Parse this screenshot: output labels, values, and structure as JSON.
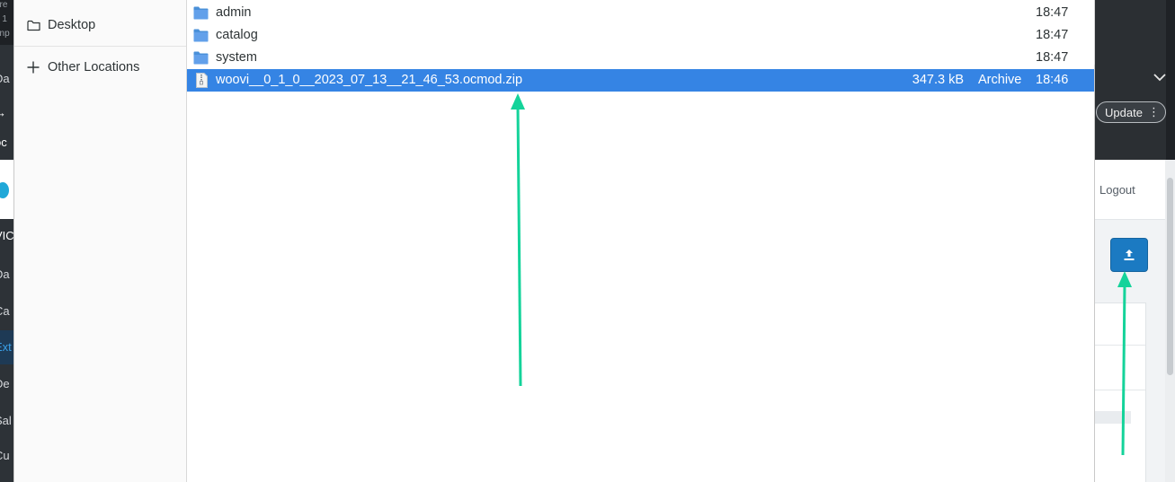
{
  "background_app": {
    "left_fragments": [
      "ere",
      "n 1",
      "enp",
      "Da",
      "oc",
      "VIC",
      "Da",
      "Ca",
      "Ext",
      "De",
      "Sal",
      "Cu"
    ],
    "update_label": "Update",
    "logout_label": "Logout"
  },
  "places": [
    {
      "label": "Desktop",
      "icon": "folder-icon"
    },
    {
      "label": "Other Locations",
      "icon": "plus-icon"
    }
  ],
  "files": [
    {
      "name": "admin",
      "size": "",
      "type": "",
      "modified": "18:47",
      "icon": "folder-icon",
      "selected": false
    },
    {
      "name": "catalog",
      "size": "",
      "type": "",
      "modified": "18:47",
      "icon": "folder-icon",
      "selected": false
    },
    {
      "name": "system",
      "size": "",
      "type": "",
      "modified": "18:47",
      "icon": "folder-icon",
      "selected": false
    },
    {
      "name": "woovi__0_1_0__2023_07_13__21_46_53.ocmod.zip",
      "size": "347.3 kB",
      "type": "Archive",
      "modified": "18:46",
      "icon": "archive-icon",
      "selected": true
    }
  ],
  "colors": {
    "selection": "#3584e4",
    "annotation_arrow": "#14d39a",
    "upload_button": "#1b7ac2"
  }
}
